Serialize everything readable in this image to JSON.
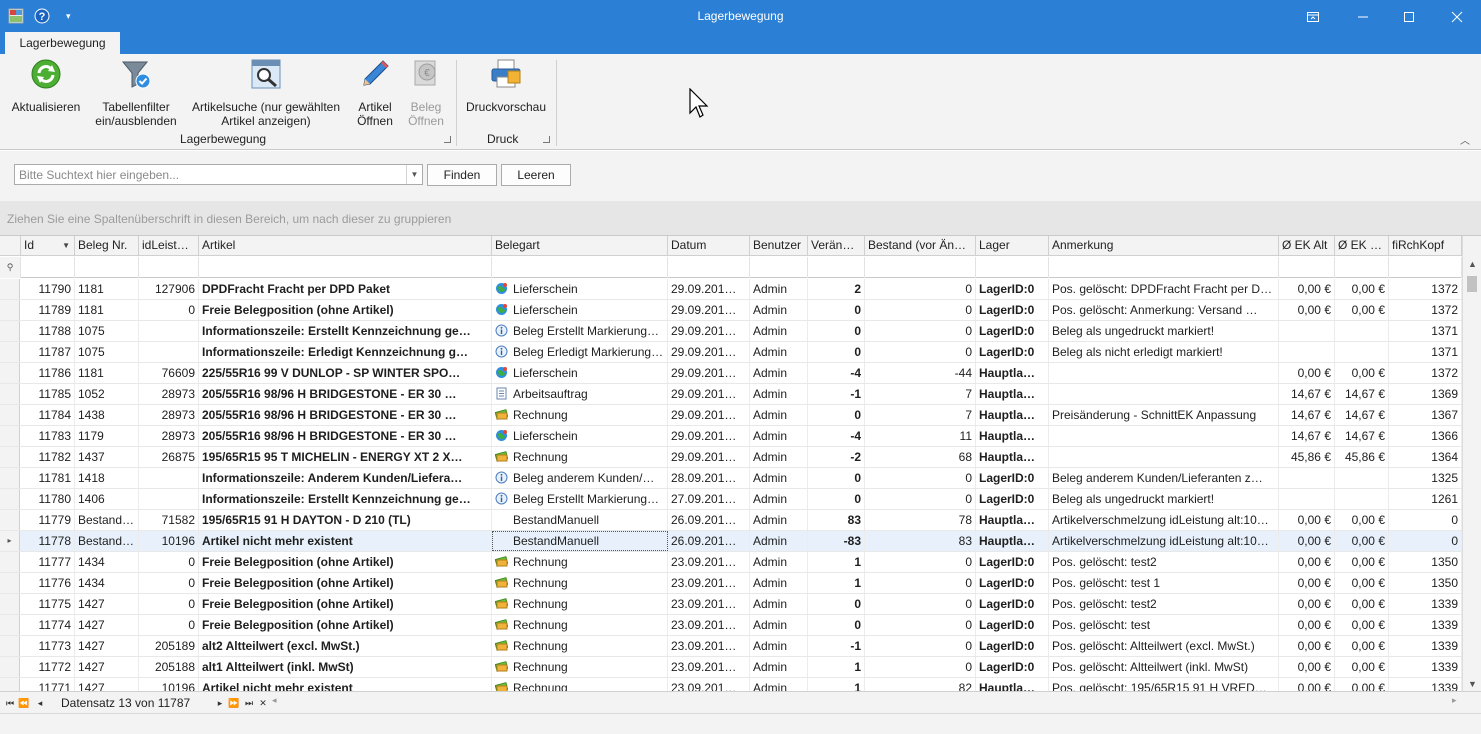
{
  "window": {
    "title": "Lagerbewegung"
  },
  "ribbon": {
    "tab_label": "Lagerbewegung",
    "buttons": {
      "refresh": "Aktualisieren",
      "filter_l1": "Tabellenfilter",
      "filter_l2": "ein/ausblenden",
      "artsearch_l1": "Artikelsuche (nur gewählten",
      "artsearch_l2": "Artikel anzeigen)",
      "artopen_l1": "Artikel",
      "artopen_l2": "Öffnen",
      "belegopen_l1": "Beleg",
      "belegopen_l2": "Öffnen",
      "preview": "Druckvorschau"
    },
    "groups": {
      "lager": "Lagerbewegung",
      "druck": "Druck"
    }
  },
  "search": {
    "placeholder": "Bitte Suchtext hier eingeben...",
    "find_label": "Finden",
    "clear_label": "Leeren"
  },
  "group_panel_text": "Ziehen Sie eine Spaltenüberschrift in diesen Bereich, um nach dieser zu gruppieren",
  "columns": [
    "Id",
    "Beleg Nr.",
    "idLeist…",
    "Artikel",
    "Belegart",
    "Datum",
    "Benutzer",
    "Verän…",
    "Bestand (vor Än…",
    "Lager",
    "Anmerkung",
    "Ø EK Alt",
    "Ø EK …",
    "fiRchKopf"
  ],
  "rows": [
    {
      "id": "11790",
      "beleg": "1181",
      "idl": "127906",
      "artikel": "DPDFracht Fracht per DPD Paket",
      "belegart": "Lieferschein",
      "icon": "globe",
      "datum": "29.09.201…",
      "benutzer": "Admin",
      "ver": "2",
      "bestand": "0",
      "lager": "LagerID:0",
      "anm": "Pos. gelöscht: DPDFracht Fracht per D…",
      "ekalt": "0,00 €",
      "ek": "0,00 €",
      "fi": "1372"
    },
    {
      "id": "11789",
      "beleg": "1181",
      "idl": "0",
      "artikel": "Freie Belegposition (ohne Artikel)",
      "belegart": "Lieferschein",
      "icon": "globe",
      "datum": "29.09.201…",
      "benutzer": "Admin",
      "ver": "0",
      "bestand": "0",
      "lager": "LagerID:0",
      "anm": "Pos. gelöscht:  Anmerkung: Versand …",
      "ekalt": "0,00 €",
      "ek": "0,00 €",
      "fi": "1372"
    },
    {
      "id": "11788",
      "beleg": "1075",
      "idl": "",
      "artikel": "Informationszeile: Erstellt Kennzeichnung ge…",
      "belegart": "Beleg Erstellt Markierung…",
      "icon": "info",
      "datum": "29.09.201…",
      "benutzer": "Admin",
      "ver": "0",
      "bestand": "0",
      "lager": "LagerID:0",
      "anm": "Beleg als ungedruckt markiert!",
      "ekalt": "",
      "ek": "",
      "fi": "1371"
    },
    {
      "id": "11787",
      "beleg": "1075",
      "idl": "",
      "artikel": "Informationszeile: Erledigt Kennzeichnung g…",
      "belegart": "Beleg Erledigt Markierung…",
      "icon": "info",
      "datum": "29.09.201…",
      "benutzer": "Admin",
      "ver": "0",
      "bestand": "0",
      "lager": "LagerID:0",
      "anm": "Beleg als nicht erledigt markiert!",
      "ekalt": "",
      "ek": "",
      "fi": "1371"
    },
    {
      "id": "11786",
      "beleg": "1181",
      "idl": "76609",
      "artikel": "225/55R16 99 V DUNLOP - SP WINTER SPO…",
      "belegart": "Lieferschein",
      "icon": "globe",
      "datum": "29.09.201…",
      "benutzer": "Admin",
      "ver": "-4",
      "bestand": "-44",
      "lager": "Hauptla…",
      "anm": "",
      "ekalt": "0,00 €",
      "ek": "0,00 €",
      "fi": "1372"
    },
    {
      "id": "11785",
      "beleg": "1052",
      "idl": "28973",
      "artikel": "205/55R16 98/96 H BRIDGESTONE - ER 30 …",
      "belegart": "Arbeitsauftrag",
      "icon": "doc",
      "datum": "29.09.201…",
      "benutzer": "Admin",
      "ver": "-1",
      "bestand": "7",
      "lager": "Hauptla…",
      "anm": "",
      "ekalt": "14,67 €",
      "ek": "14,67 €",
      "fi": "1369"
    },
    {
      "id": "11784",
      "beleg": "1438",
      "idl": "28973",
      "artikel": "205/55R16 98/96 H BRIDGESTONE - ER 30 …",
      "belegart": "Rechnung",
      "icon": "money",
      "datum": "29.09.201…",
      "benutzer": "Admin",
      "ver": "0",
      "bestand": "7",
      "lager": "Hauptla…",
      "anm": "Preisänderung - SchnittEK Anpassung",
      "ekalt": "14,67 €",
      "ek": "14,67 €",
      "fi": "1367"
    },
    {
      "id": "11783",
      "beleg": "1179",
      "idl": "28973",
      "artikel": "205/55R16 98/96 H BRIDGESTONE - ER 30 …",
      "belegart": "Lieferschein",
      "icon": "globe",
      "datum": "29.09.201…",
      "benutzer": "Admin",
      "ver": "-4",
      "bestand": "11",
      "lager": "Hauptla…",
      "anm": "",
      "ekalt": "14,67 €",
      "ek": "14,67 €",
      "fi": "1366"
    },
    {
      "id": "11782",
      "beleg": "1437",
      "idl": "26875",
      "artikel": "195/65R15 95 T MICHELIN - ENERGY XT 2 X…",
      "belegart": "Rechnung",
      "icon": "money",
      "datum": "29.09.201…",
      "benutzer": "Admin",
      "ver": "-2",
      "bestand": "68",
      "lager": "Hauptla…",
      "anm": "",
      "ekalt": "45,86 €",
      "ek": "45,86 €",
      "fi": "1364"
    },
    {
      "id": "11781",
      "beleg": "1418",
      "idl": "",
      "artikel": "Informationszeile: Anderem Kunden/Liefera…",
      "belegart": "Beleg anderem Kunden/…",
      "icon": "info",
      "datum": "28.09.201…",
      "benutzer": "Admin",
      "ver": "0",
      "bestand": "0",
      "lager": "LagerID:0",
      "anm": "Beleg anderem Kunden/Lieferanten z…",
      "ekalt": "",
      "ek": "",
      "fi": "1325"
    },
    {
      "id": "11780",
      "beleg": "1406",
      "idl": "",
      "artikel": "Informationszeile: Erstellt Kennzeichnung ge…",
      "belegart": "Beleg Erstellt Markierung…",
      "icon": "info",
      "datum": "27.09.201…",
      "benutzer": "Admin",
      "ver": "0",
      "bestand": "0",
      "lager": "LagerID:0",
      "anm": "Beleg als ungedruckt markiert!",
      "ekalt": "",
      "ek": "",
      "fi": "1261"
    },
    {
      "id": "11779",
      "beleg": "Bestand…",
      "idl": "71582",
      "artikel": "195/65R15 91 H DAYTON - D 210 (TL)",
      "belegart": "BestandManuell",
      "icon": "none",
      "datum": "26.09.201…",
      "benutzer": "Admin",
      "ver": "83",
      "bestand": "78",
      "lager": "Hauptla…",
      "anm": "Artikelverschmelzung idLeistung alt:10…",
      "ekalt": "0,00 €",
      "ek": "0,00 €",
      "fi": "0"
    },
    {
      "id": "11778",
      "beleg": "Bestand…",
      "idl": "10196",
      "artikel": "Artikel nicht mehr existent",
      "belegart": "BestandManuell",
      "icon": "none",
      "datum": "26.09.201…",
      "benutzer": "Admin",
      "ver": "-83",
      "bestand": "83",
      "lager": "Hauptla…",
      "anm": "Artikelverschmelzung idLeistung alt:10…",
      "ekalt": "0,00 €",
      "ek": "0,00 €",
      "fi": "0",
      "focused": true
    },
    {
      "id": "11777",
      "beleg": "1434",
      "idl": "0",
      "artikel": "Freie Belegposition (ohne Artikel)",
      "belegart": "Rechnung",
      "icon": "money",
      "datum": "23.09.201…",
      "benutzer": "Admin",
      "ver": "1",
      "bestand": "0",
      "lager": "LagerID:0",
      "anm": "Pos. gelöscht:  test2",
      "ekalt": "0,00 €",
      "ek": "0,00 €",
      "fi": "1350"
    },
    {
      "id": "11776",
      "beleg": "1434",
      "idl": "0",
      "artikel": "Freie Belegposition (ohne Artikel)",
      "belegart": "Rechnung",
      "icon": "money",
      "datum": "23.09.201…",
      "benutzer": "Admin",
      "ver": "1",
      "bestand": "0",
      "lager": "LagerID:0",
      "anm": "Pos. gelöscht: test 1",
      "ekalt": "0,00 €",
      "ek": "0,00 €",
      "fi": "1350"
    },
    {
      "id": "11775",
      "beleg": "1427",
      "idl": "0",
      "artikel": "Freie Belegposition (ohne Artikel)",
      "belegart": "Rechnung",
      "icon": "money",
      "datum": "23.09.201…",
      "benutzer": "Admin",
      "ver": "0",
      "bestand": "0",
      "lager": "LagerID:0",
      "anm": "Pos. gelöscht:  test2",
      "ekalt": "0,00 €",
      "ek": "0,00 €",
      "fi": "1339"
    },
    {
      "id": "11774",
      "beleg": "1427",
      "idl": "0",
      "artikel": "Freie Belegposition (ohne Artikel)",
      "belegart": "Rechnung",
      "icon": "money",
      "datum": "23.09.201…",
      "benutzer": "Admin",
      "ver": "0",
      "bestand": "0",
      "lager": "LagerID:0",
      "anm": "Pos. gelöscht:  test",
      "ekalt": "0,00 €",
      "ek": "0,00 €",
      "fi": "1339"
    },
    {
      "id": "11773",
      "beleg": "1427",
      "idl": "205189",
      "artikel": "alt2 Altteilwert (excl. MwSt.)",
      "belegart": "Rechnung",
      "icon": "money",
      "datum": "23.09.201…",
      "benutzer": "Admin",
      "ver": "-1",
      "bestand": "0",
      "lager": "LagerID:0",
      "anm": "Pos. gelöscht:  Altteilwert (excl. MwSt.)",
      "ekalt": "0,00 €",
      "ek": "0,00 €",
      "fi": "1339"
    },
    {
      "id": "11772",
      "beleg": "1427",
      "idl": "205188",
      "artikel": "alt1 Altteilwert (inkl. MwSt)",
      "belegart": "Rechnung",
      "icon": "money",
      "datum": "23.09.201…",
      "benutzer": "Admin",
      "ver": "1",
      "bestand": "0",
      "lager": "LagerID:0",
      "anm": "Pos. gelöscht:  Altteilwert (inkl. MwSt)",
      "ekalt": "0,00 €",
      "ek": "0,00 €",
      "fi": "1339"
    },
    {
      "id": "11771",
      "beleg": "1427",
      "idl": "10196",
      "artikel": "Artikel nicht mehr existent",
      "belegart": "Rechnung",
      "icon": "money",
      "datum": "23.09.201…",
      "benutzer": "Admin",
      "ver": "1",
      "bestand": "82",
      "lager": "Hauptla…",
      "anm": "Pos. gelöscht: 195/65R15 91 H VRED…",
      "ekalt": "0,00 €",
      "ek": "0,00 €",
      "fi": "1339"
    }
  ],
  "navigator": {
    "record_text": "Datensatz 13 von 11787"
  },
  "colors": {
    "titlebar": "#2b7fd4",
    "ribbon": "#f3f3f3",
    "focused_row": "#e8f1fb"
  }
}
